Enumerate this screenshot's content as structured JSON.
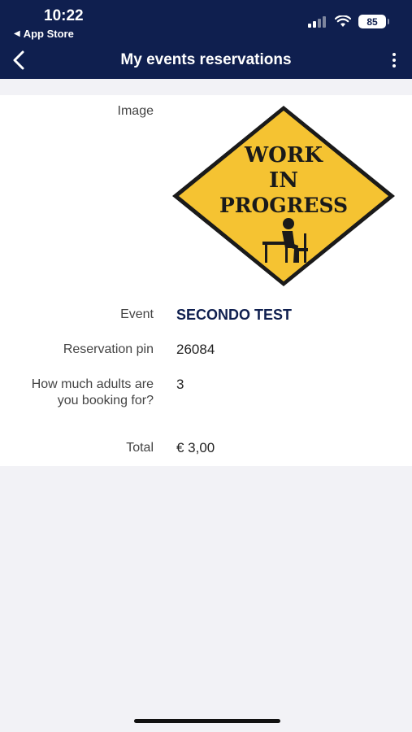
{
  "status_bar": {
    "time": "10:22",
    "back_app": "App Store",
    "battery": "85"
  },
  "nav": {
    "title": "My events reservations"
  },
  "details": {
    "image_label": "Image",
    "sign_lines": [
      "WORK",
      "IN",
      "PROGRESS"
    ],
    "event_label": "Event",
    "event_value": "SECONDO TEST",
    "pin_label": "Reservation pin",
    "pin_value": "26084",
    "adults_label": "How much adults are you booking for?",
    "adults_value": "3",
    "total_label": "Total",
    "total_value": "€ 3,00"
  },
  "colors": {
    "header_bg": "#0f1f4f",
    "sign_yellow": "#f5c332",
    "event_text": "#0f1f4f"
  },
  "icons": [
    "back-chevron-icon",
    "more-vertical-icon",
    "signal-icon",
    "wifi-icon",
    "battery-icon"
  ]
}
